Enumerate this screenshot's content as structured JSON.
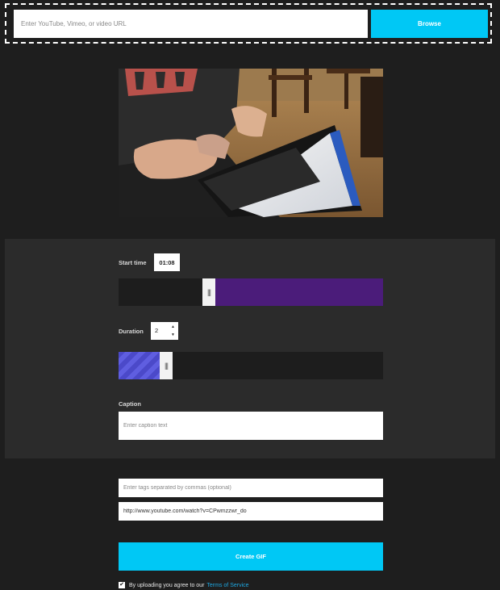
{
  "source": {
    "placeholder": "Enter YouTube, Vimeo, or video URL",
    "browse_label": "Browse"
  },
  "settings": {
    "start_time_label": "Start time",
    "start_time_value": "01:08",
    "duration_label": "Duration",
    "duration_value": "2",
    "caption_label": "Caption",
    "caption_placeholder": "Enter caption text"
  },
  "details": {
    "tags_placeholder": "Enter tags separated by commas (optional)",
    "source_url": "http://www.youtube.com/watch?v=CPwmzzwr_do"
  },
  "actions": {
    "create_label": "Create GIF",
    "terms_text": "By uploading you agree to our",
    "terms_link": "Terms of Service",
    "terms_checked": true
  },
  "sliders": {
    "start_fraction": 0.34,
    "duration_fraction": 0.18
  },
  "icons": {
    "handle_grip": "grip-lines-icon",
    "checkbox": "checkmark-icon"
  },
  "colors": {
    "accent": "#00c8f5",
    "start_fill": "#4b1c7a",
    "duration_fill": "#4b49c9",
    "link": "#1ea7e1"
  }
}
